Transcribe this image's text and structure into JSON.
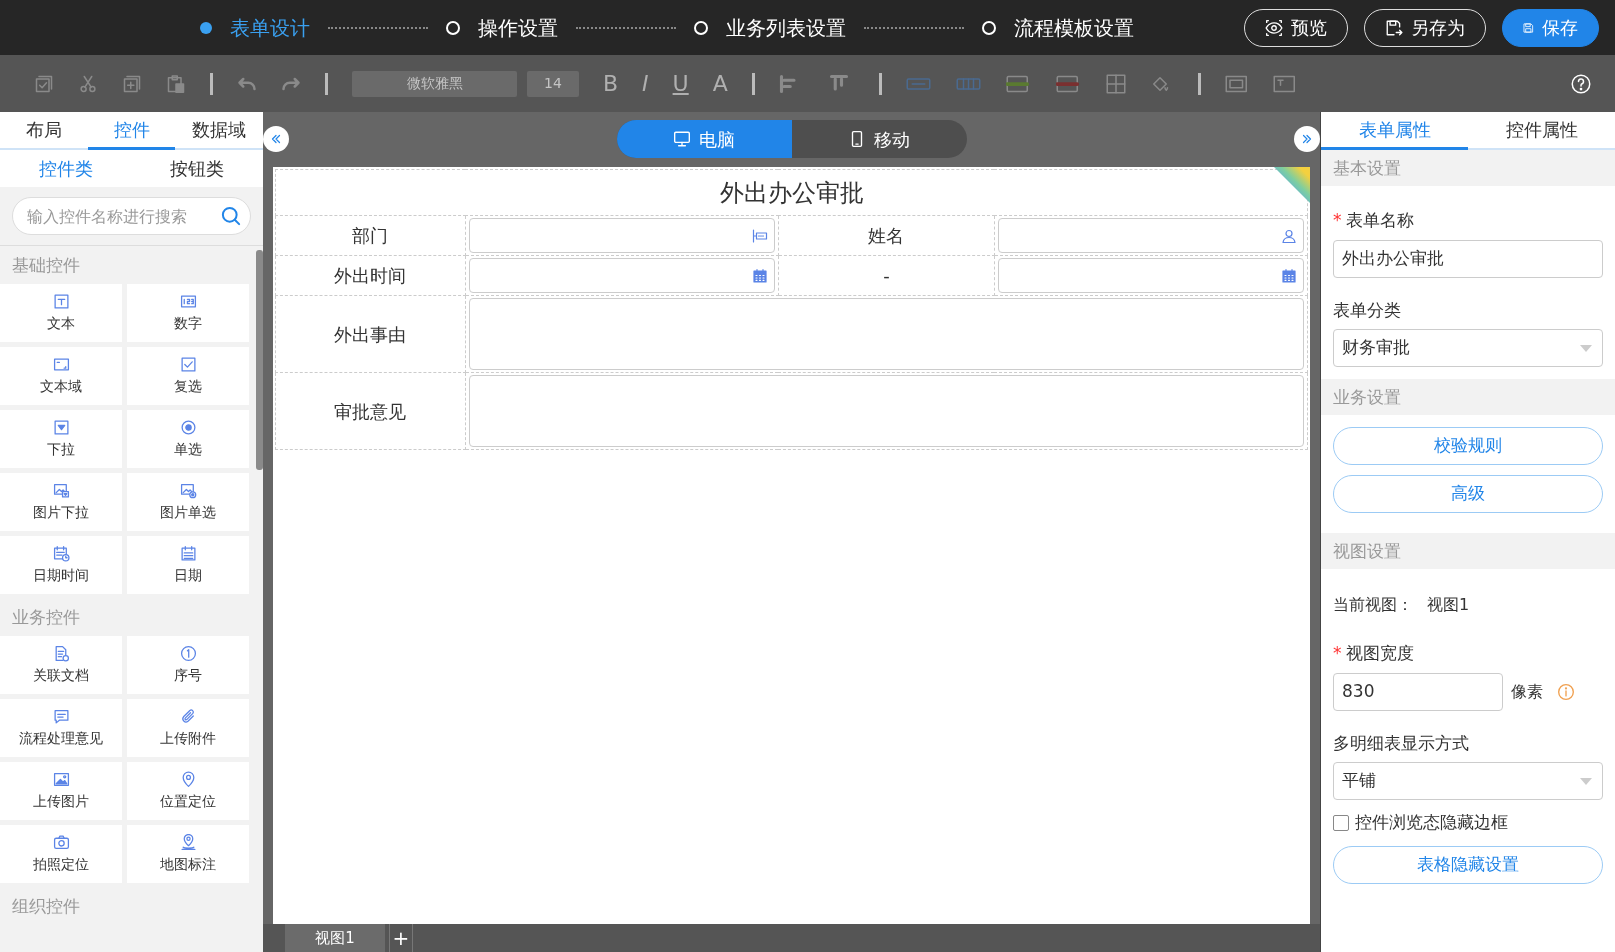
{
  "steps": [
    {
      "label": "表单设计",
      "selected": true
    },
    {
      "label": "操作设置",
      "selected": false
    },
    {
      "label": "业务列表设置",
      "selected": false
    },
    {
      "label": "流程模板设置",
      "selected": false
    }
  ],
  "header_buttons": [
    {
      "kind": "preview",
      "label": "预览"
    },
    {
      "kind": "save-as",
      "label": "另存为"
    },
    {
      "kind": "save",
      "label": "保存"
    }
  ],
  "toolbar": {
    "font": "微软雅黑",
    "size": "14",
    "format_glyphs": [
      "B",
      "I",
      "U",
      "A"
    ]
  },
  "left_panel": {
    "tabs": [
      {
        "label": "布局",
        "selected": false
      },
      {
        "label": "控件",
        "selected": true
      },
      {
        "label": "数据域",
        "selected": false
      }
    ],
    "subtabs": [
      {
        "label": "控件类",
        "selected": true
      },
      {
        "label": "按钮类",
        "selected": false
      }
    ],
    "search": {
      "placeholder": "输入控件名称进行搜索"
    },
    "groups": [
      {
        "title": "基础控件",
        "items": [
          {
            "kind": "text",
            "label": "文本"
          },
          {
            "kind": "number",
            "label": "数字"
          },
          {
            "kind": "textarea",
            "label": "文本域"
          },
          {
            "kind": "checkbox",
            "label": "复选"
          },
          {
            "kind": "select",
            "label": "下拉"
          },
          {
            "kind": "radio",
            "label": "单选"
          },
          {
            "kind": "image-select",
            "label": "图片下拉"
          },
          {
            "kind": "image-radio",
            "label": "图片单选"
          },
          {
            "kind": "datetime",
            "label": "日期时间"
          },
          {
            "kind": "date",
            "label": "日期"
          }
        ]
      },
      {
        "title": "业务控件",
        "items": [
          {
            "kind": "document",
            "label": "关联文档"
          },
          {
            "kind": "serial",
            "label": "序号"
          },
          {
            "kind": "comment",
            "label": "流程处理意见"
          },
          {
            "kind": "attachment",
            "label": "上传附件"
          },
          {
            "kind": "image",
            "label": "上传图片"
          },
          {
            "kind": "location",
            "label": "位置定位"
          },
          {
            "kind": "camera",
            "label": "拍照定位"
          },
          {
            "kind": "map",
            "label": "地图标注"
          }
        ]
      },
      {
        "title": "组织控件"
      }
    ]
  },
  "view_switch": [
    {
      "kind": "desktop",
      "label": "电脑",
      "selected": true
    },
    {
      "kind": "mobile",
      "label": "移动",
      "selected": false
    }
  ],
  "form": {
    "title": "外出办公审批",
    "rows": [
      {
        "cells": [
          {
            "kind": "label",
            "text": "部门"
          },
          {
            "kind": "org-input"
          },
          {
            "kind": "label",
            "text": "姓名"
          },
          {
            "kind": "user-input"
          }
        ]
      },
      {
        "cells": [
          {
            "kind": "label",
            "text": "外出时间"
          },
          {
            "kind": "date-input"
          },
          {
            "kind": "label",
            "text": "-"
          },
          {
            "kind": "date-input"
          }
        ]
      },
      {
        "cells": [
          {
            "kind": "label",
            "text": "外出事由"
          },
          {
            "kind": "textarea"
          }
        ]
      },
      {
        "cells": [
          {
            "kind": "label",
            "text": "审批意见"
          },
          {
            "kind": "textarea"
          }
        ]
      }
    ]
  },
  "sheet_tabs": [
    {
      "label": "视图1",
      "selected": true
    }
  ],
  "add_sheet": "+",
  "right_panel": {
    "tabs": [
      {
        "label": "表单属性",
        "selected": true
      },
      {
        "label": "控件属性",
        "selected": false
      }
    ],
    "sections": [
      {
        "title": "基本设置",
        "items": [
          {
            "kind": "input",
            "label": "表单名称",
            "required_mark": "*",
            "value": "外出办公审批"
          },
          {
            "kind": "select",
            "label": "表单分类",
            "value": "财务审批"
          }
        ]
      },
      {
        "title": "业务设置",
        "items": [
          {
            "kind": "button",
            "text": "校验规则"
          },
          {
            "kind": "button",
            "text": "高级"
          }
        ]
      },
      {
        "title": "视图设置",
        "items": [
          {
            "kind": "info",
            "label": "当前视图：",
            "value": "视图1"
          },
          {
            "kind": "input",
            "label": "视图宽度",
            "required_mark": "*",
            "value": "830",
            "unit": "像素"
          },
          {
            "kind": "select",
            "label": "多明细表显示方式",
            "value": "平铺"
          },
          {
            "kind": "checkbox",
            "text": "控件浏览态隐藏边框",
            "checked": false
          },
          {
            "kind": "button",
            "text": "表格隐藏设置"
          }
        ]
      }
    ]
  }
}
